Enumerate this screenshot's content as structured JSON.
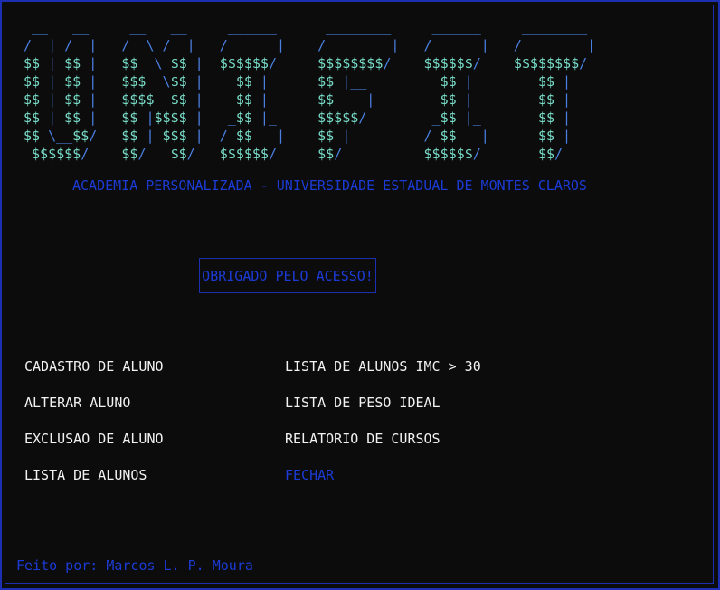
{
  "colors": {
    "background": "#0c0c0c",
    "border": "#1c2fb0",
    "blue_text": "#1c3bd6",
    "white_text": "#f2f2f2",
    "banner_outline": "#4a7fe0",
    "banner_fill": "#78dcc8"
  },
  "banner": {
    "lines": [
      " __   __     __   __     ______      ________     ______     ________ ",
      "/  | /  |   /  \\ /  |   /      |    /        |   /      |   /        |",
      "$$ | $$ |   $$  \\ $$ |  $$$$$$/     $$$$$$$$/    $$$$$$/    $$$$$$$$/",
      "$$ | $$ |   $$$  \\$$ |    $$ |      $$ |__         $$ |        $$ |  ",
      "$$ | $$ |   $$$$  $$ |    $$ |      $$    |        $$ |        $$ |  ",
      "$$ | $$ |   $$ |$$$$ |   _$$ |_     $$$$$/        _$$ |_       $$ |  ",
      "$$ \\__$$/   $$ | $$$ |  / $$   |    $$ |         / $$   |      $$ |  ",
      " $$$$$$/    $$/   $$/   $$$$$$/     $$/          $$$$$$/       $$/   "
    ]
  },
  "subtitle": "ACADEMIA PERSONALIZADA - UNIVERSIDADE ESTADUAL DE MONTES CLAROS",
  "thanks_message": "OBRIGADO PELO ACESSO!",
  "menu": {
    "cadastro": "CADASTRO DE ALUNO",
    "alterar": "ALTERAR ALUNO",
    "exclusao": "EXCLUSAO DE ALUNO",
    "lista_alunos": "LISTA DE ALUNOS",
    "lista_imc": "LISTA DE ALUNOS IMC > 30",
    "lista_peso": "LISTA DE PESO IDEAL",
    "relatorio": "RELATORIO DE CURSOS",
    "fechar": "FECHAR"
  },
  "footer": "Feito por: Marcos L. P. Moura"
}
